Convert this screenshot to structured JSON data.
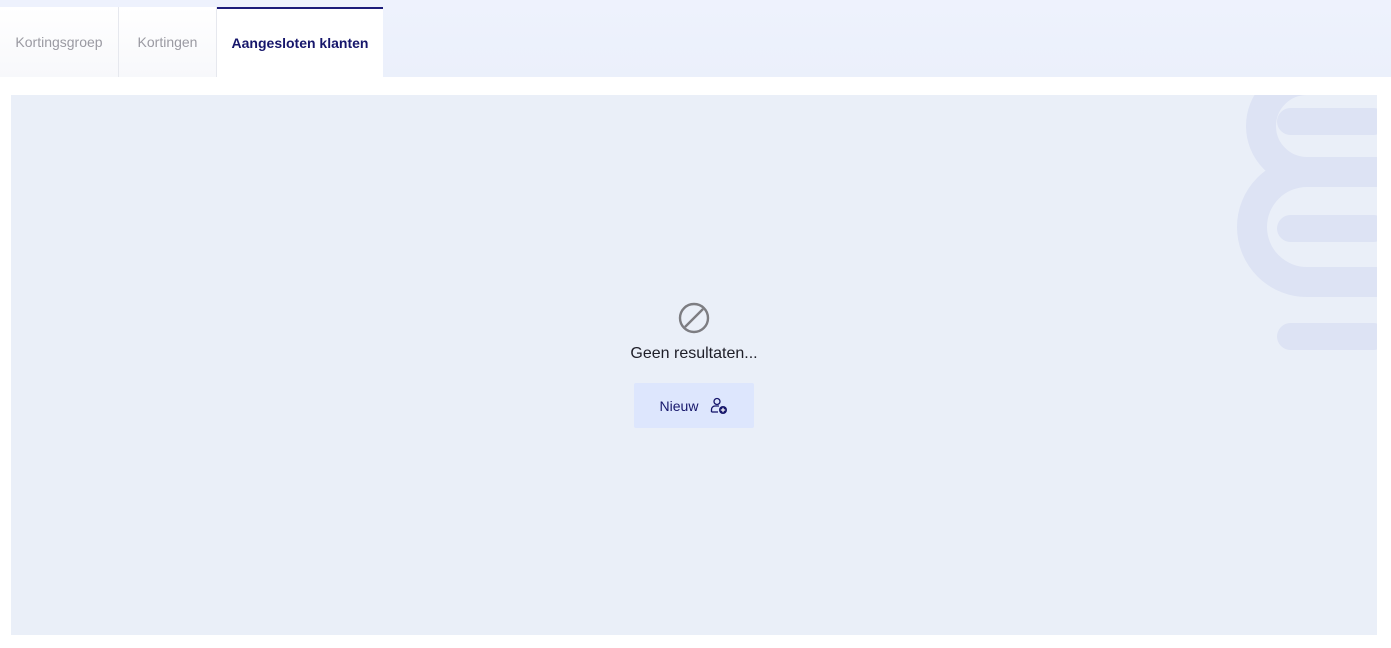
{
  "tabs": [
    {
      "label": "Kortingsgroep",
      "active": false
    },
    {
      "label": "Kortingen",
      "active": false
    },
    {
      "label": "Aangesloten klanten",
      "active": true
    }
  ],
  "empty_state": {
    "icon": "ban-icon",
    "message": "Geen resultaten...",
    "new_button_label": "Nieuw",
    "new_button_icon": "user-add-icon"
  },
  "colors": {
    "accent": "#16166b",
    "panel_background": "#eaeff8",
    "button_background": "#dde6fd"
  }
}
